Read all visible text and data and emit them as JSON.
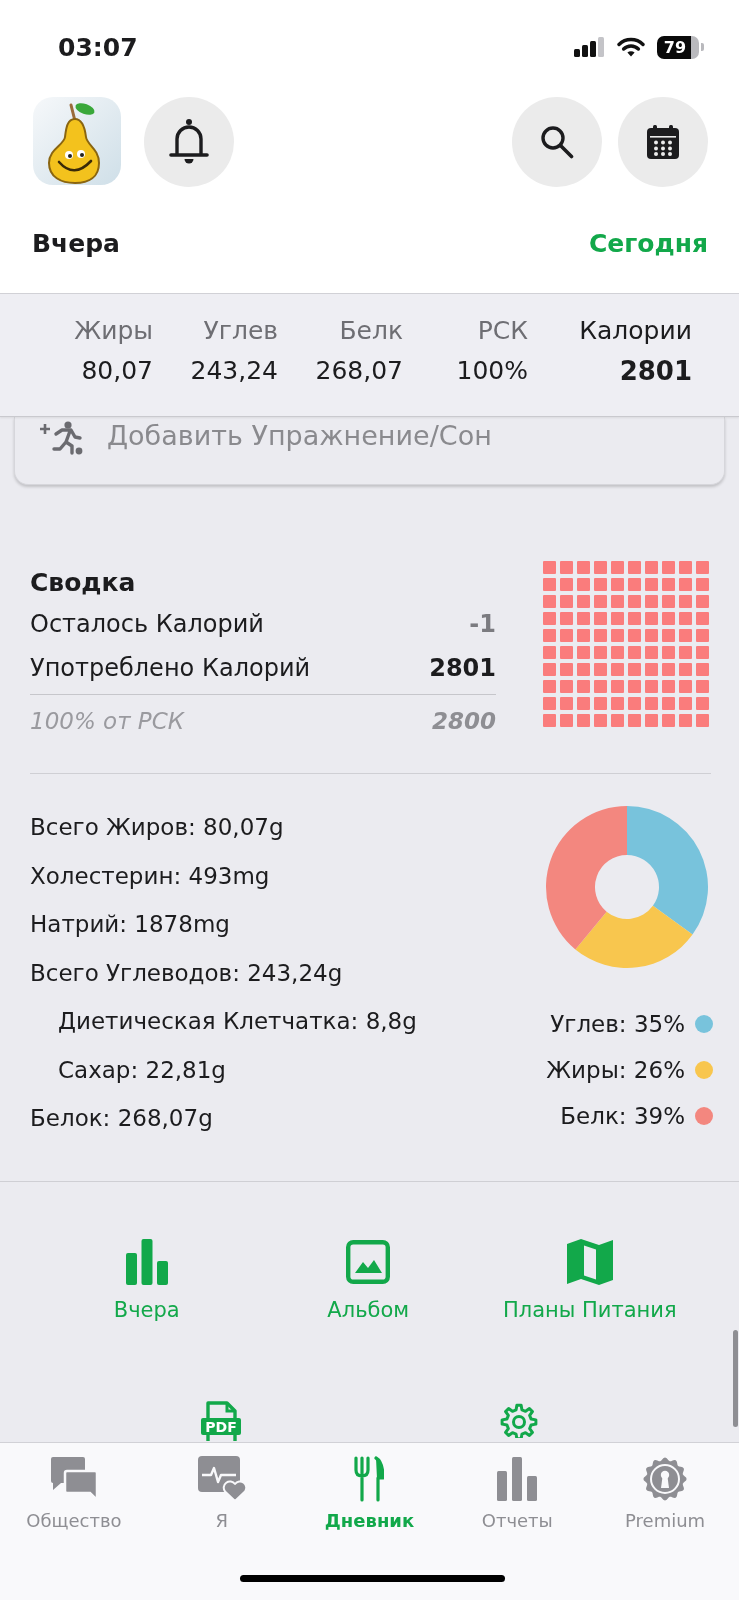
{
  "status_bar": {
    "time": "03:07",
    "battery": "79"
  },
  "header": {
    "date_title": "Вчера",
    "today_button": "Сегодня"
  },
  "totals": [
    {
      "label": "Жиры",
      "value": "80,07",
      "kind": "macro"
    },
    {
      "label": "Углев",
      "value": "243,24",
      "kind": "macro"
    },
    {
      "label": "Белк",
      "value": "268,07",
      "kind": "macro"
    },
    {
      "label": "РСК",
      "value": "100%",
      "kind": "macro"
    },
    {
      "label": "Калории",
      "value": "2801",
      "kind": "total"
    }
  ],
  "exercise_card": {
    "label": "Добавить Упражнение/Сон"
  },
  "summary": {
    "title": "Сводка",
    "rows": [
      {
        "label": "Осталось Калорий",
        "value": "-1",
        "kind": "muted"
      },
      {
        "label": "Употреблено Калорий",
        "value": "2801",
        "kind": "strong"
      }
    ],
    "goal": {
      "label": "100% от РСК",
      "value": "2800"
    }
  },
  "nutrients": [
    {
      "text": "Всего Жиров: 80,07g"
    },
    {
      "text": "Холестерин: 493mg"
    },
    {
      "text": "Натрий: 1878mg"
    },
    {
      "text": "Всего Углеводов: 243,24g",
      "children": [
        {
          "text": "Диетическая Клетчатка: 8,8g"
        },
        {
          "text": "Сахар: 22,81g"
        }
      ]
    },
    {
      "text": "Белок: 268,07g"
    }
  ],
  "macro_chart": {
    "chart_data": {
      "type": "donut",
      "values": [
        35,
        26,
        39
      ]
    },
    "legend": [
      {
        "label": "Углев: 35%",
        "color": "#78c3dc"
      },
      {
        "label": "Жиры: 26%",
        "color": "#f8c64e"
      },
      {
        "label": "Белк: 39%",
        "color": "#f3877f"
      }
    ]
  },
  "actions": [
    {
      "label": "Вчера",
      "kind": "chart"
    },
    {
      "label": "Альбом",
      "kind": "album"
    },
    {
      "label": "Планы Питания",
      "kind": "plans"
    }
  ],
  "more_actions": [
    {
      "kind": "pdf",
      "icon_text": "PDF"
    },
    {
      "kind": "settings"
    }
  ],
  "tab_bar": [
    {
      "label": "Общество",
      "kind": "community",
      "selected": false
    },
    {
      "label": "Я",
      "kind": "me",
      "selected": false
    },
    {
      "label": "Дневник",
      "kind": "diary",
      "selected": true
    },
    {
      "label": "Отчеты",
      "kind": "reports",
      "selected": false
    },
    {
      "label": "Premium",
      "kind": "premium",
      "selected": false
    }
  ]
}
